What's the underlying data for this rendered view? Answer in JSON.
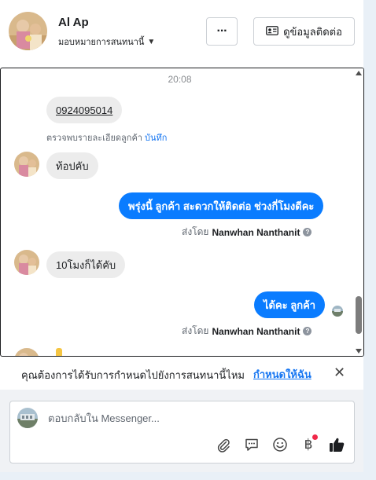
{
  "header": {
    "contact_name": "Al Ap",
    "assign_label": "มอบหมายการสนทนานี้",
    "more_label": "···",
    "contact_button": "ดูข้อมูลติดต่อ"
  },
  "conversation": {
    "timestamp": "20:08",
    "phone_message": "0924095014",
    "customer_details_text": "ตรวจพบรายละเอียดลูกค้า",
    "save_link": "บันทึก",
    "message_1": "ท้อปคับ",
    "reply_1": "พรุ่งนี้ ลูกค้า  สะดวกให้ติดต่อ ช่วงกี่โมงดีคะ",
    "sent_by_prefix_1": "ส่งโดย",
    "sent_by_name_1": "Nanwhan Nanthanit",
    "message_2": "10โมงก็ได้คับ",
    "reply_2": "ได้คะ  ลูกค้า",
    "sent_by_prefix_2": "ส่งโดย",
    "sent_by_name_2": "Nanwhan Nanthanit"
  },
  "assign_bar": {
    "question": "คุณต้องการได้รับการกำหนดไปยังการสนทนานี้ไหม",
    "assign_link": "กำหนดให้ฉัน",
    "close": "✕"
  },
  "composer": {
    "placeholder": "ตอบกลับใน Messenger..."
  },
  "colors": {
    "brand_blue": "#0a7cff",
    "link_blue": "#1877f2",
    "incoming_bubble": "#ececec",
    "notification_dot": "#f02849"
  }
}
